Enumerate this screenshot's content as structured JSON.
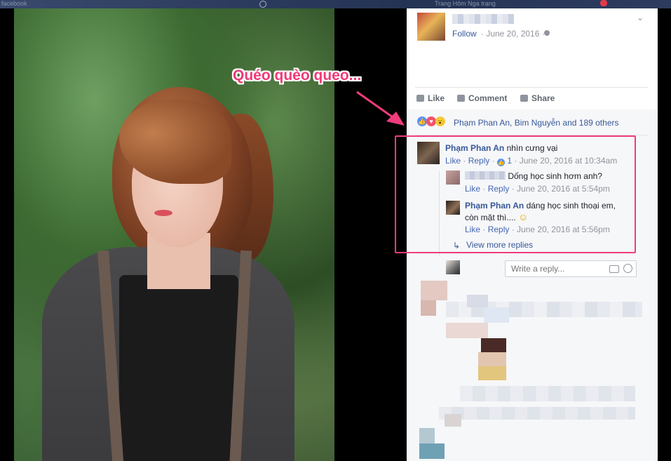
{
  "topbar": {
    "left_text": "facebook",
    "right_text": "Trang Hôm    Nga trạng"
  },
  "post": {
    "follow_label": "Follow",
    "date": "· June 20, 2016 ·",
    "actions": {
      "like": "Like",
      "comment": "Comment",
      "share": "Share"
    },
    "reactions_text": "Phạm Phan An, Bim Nguyễn and 189 others"
  },
  "comments": [
    {
      "author": "Phạm Phan An",
      "text": "nhìn cưng vại",
      "like": "Like",
      "reply": "Reply",
      "like_count": "1",
      "timestamp": "· June 20, 2016 at 10:34am"
    }
  ],
  "replies": [
    {
      "text": "Dống học sinh hơm anh?",
      "like": "Like",
      "reply": "Reply",
      "timestamp": "· June 20, 2016 at 5:54pm"
    },
    {
      "author": "Phạm Phan An",
      "text_line1": "dáng học sinh thoại em,",
      "text_line2": "còn mặt thì.... ",
      "emoji": "☺",
      "like": "Like",
      "reply": "Reply",
      "timestamp": "· June 20, 2016 at 5:56pm"
    }
  ],
  "view_more": "View more replies",
  "reply_placeholder": "Write a reply...",
  "annotation": "Quéo quèo queo...",
  "colors": {
    "accent": "#ef3c7c",
    "link": "#365899",
    "like_blue": "#5890ff"
  }
}
